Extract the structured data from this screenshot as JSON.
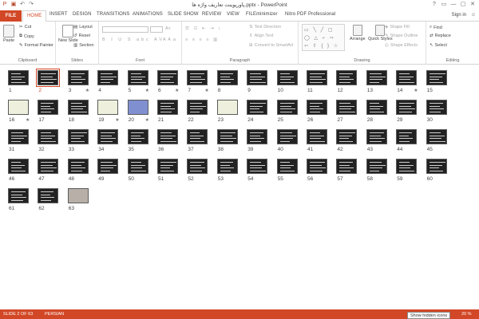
{
  "window": {
    "title": "پاورپوینت تعاریف واژه ها.pptx - PowerPoint",
    "controls": [
      "?",
      "▭",
      "—",
      "▢",
      "✕"
    ]
  },
  "tabs": [
    "FILE",
    "HOME",
    "INSERT",
    "DESIGN",
    "TRANSITIONS",
    "ANIMATIONS",
    "SLIDE SHOW",
    "REVIEW",
    "VIEW",
    "FILEminimizer",
    "Nitro PDF Professional"
  ],
  "account": {
    "sign_in": "Sign in"
  },
  "ribbon": {
    "clipboard": {
      "label": "Clipboard",
      "paste": "Paste",
      "cut": "Cut",
      "copy": "Copy",
      "format_painter": "Format Painter"
    },
    "slides": {
      "label": "Slides",
      "new_slide": "New Slide",
      "layout": "Layout",
      "reset": "Reset",
      "section": "Section"
    },
    "font": {
      "label": "Font"
    },
    "paragraph": {
      "label": "Paragraph",
      "text_direction": "Text Direction",
      "align_text": "Align Text",
      "convert_smartart": "Convert to SmartArt"
    },
    "drawing": {
      "label": "Drawing",
      "arrange": "Arrange",
      "quick_styles": "Quick Styles",
      "shape_fill": "Shape Fill",
      "shape_outline": "Shape Outline",
      "shape_effects": "Shape Effects"
    },
    "editing": {
      "label": "Editing",
      "find": "Find",
      "replace": "Replace",
      "select": "Select"
    }
  },
  "slides": [
    {
      "n": "1"
    },
    {
      "n": "2",
      "selected": true
    },
    {
      "n": "3",
      "star": true
    },
    {
      "n": "4"
    },
    {
      "n": "5",
      "star": true
    },
    {
      "n": "6",
      "star": true
    },
    {
      "n": "7",
      "star": true
    },
    {
      "n": "8"
    },
    {
      "n": "9"
    },
    {
      "n": "10"
    },
    {
      "n": "11"
    },
    {
      "n": "12"
    },
    {
      "n": "13"
    },
    {
      "n": "14",
      "star": true
    },
    {
      "n": "15"
    },
    {
      "n": "16",
      "star": true,
      "style": "light"
    },
    {
      "n": "17"
    },
    {
      "n": "18"
    },
    {
      "n": "19",
      "star": true,
      "style": "light"
    },
    {
      "n": "20",
      "star": true,
      "style": "blue"
    },
    {
      "n": "21"
    },
    {
      "n": "22"
    },
    {
      "n": "23",
      "style": "light"
    },
    {
      "n": "24"
    },
    {
      "n": "25"
    },
    {
      "n": "26"
    },
    {
      "n": "27"
    },
    {
      "n": "28"
    },
    {
      "n": "29"
    },
    {
      "n": "30"
    },
    {
      "n": "31"
    },
    {
      "n": "32"
    },
    {
      "n": "33"
    },
    {
      "n": "34"
    },
    {
      "n": "35"
    },
    {
      "n": "36"
    },
    {
      "n": "37"
    },
    {
      "n": "38"
    },
    {
      "n": "39"
    },
    {
      "n": "40"
    },
    {
      "n": "41"
    },
    {
      "n": "42"
    },
    {
      "n": "43"
    },
    {
      "n": "44"
    },
    {
      "n": "45"
    },
    {
      "n": "46"
    },
    {
      "n": "47"
    },
    {
      "n": "48"
    },
    {
      "n": "49"
    },
    {
      "n": "50"
    },
    {
      "n": "51"
    },
    {
      "n": "52"
    },
    {
      "n": "53"
    },
    {
      "n": "54"
    },
    {
      "n": "55"
    },
    {
      "n": "56"
    },
    {
      "n": "57"
    },
    {
      "n": "58"
    },
    {
      "n": "59"
    },
    {
      "n": "60"
    },
    {
      "n": "61"
    },
    {
      "n": "62"
    },
    {
      "n": "63",
      "style": "photo"
    }
  ],
  "status": {
    "slide_info": "SLIDE 2 OF 63",
    "language": "PERSIAN",
    "zoom": "20 %",
    "tooltip": "Show hidden icons"
  },
  "colors": {
    "accent": "#d24726"
  }
}
